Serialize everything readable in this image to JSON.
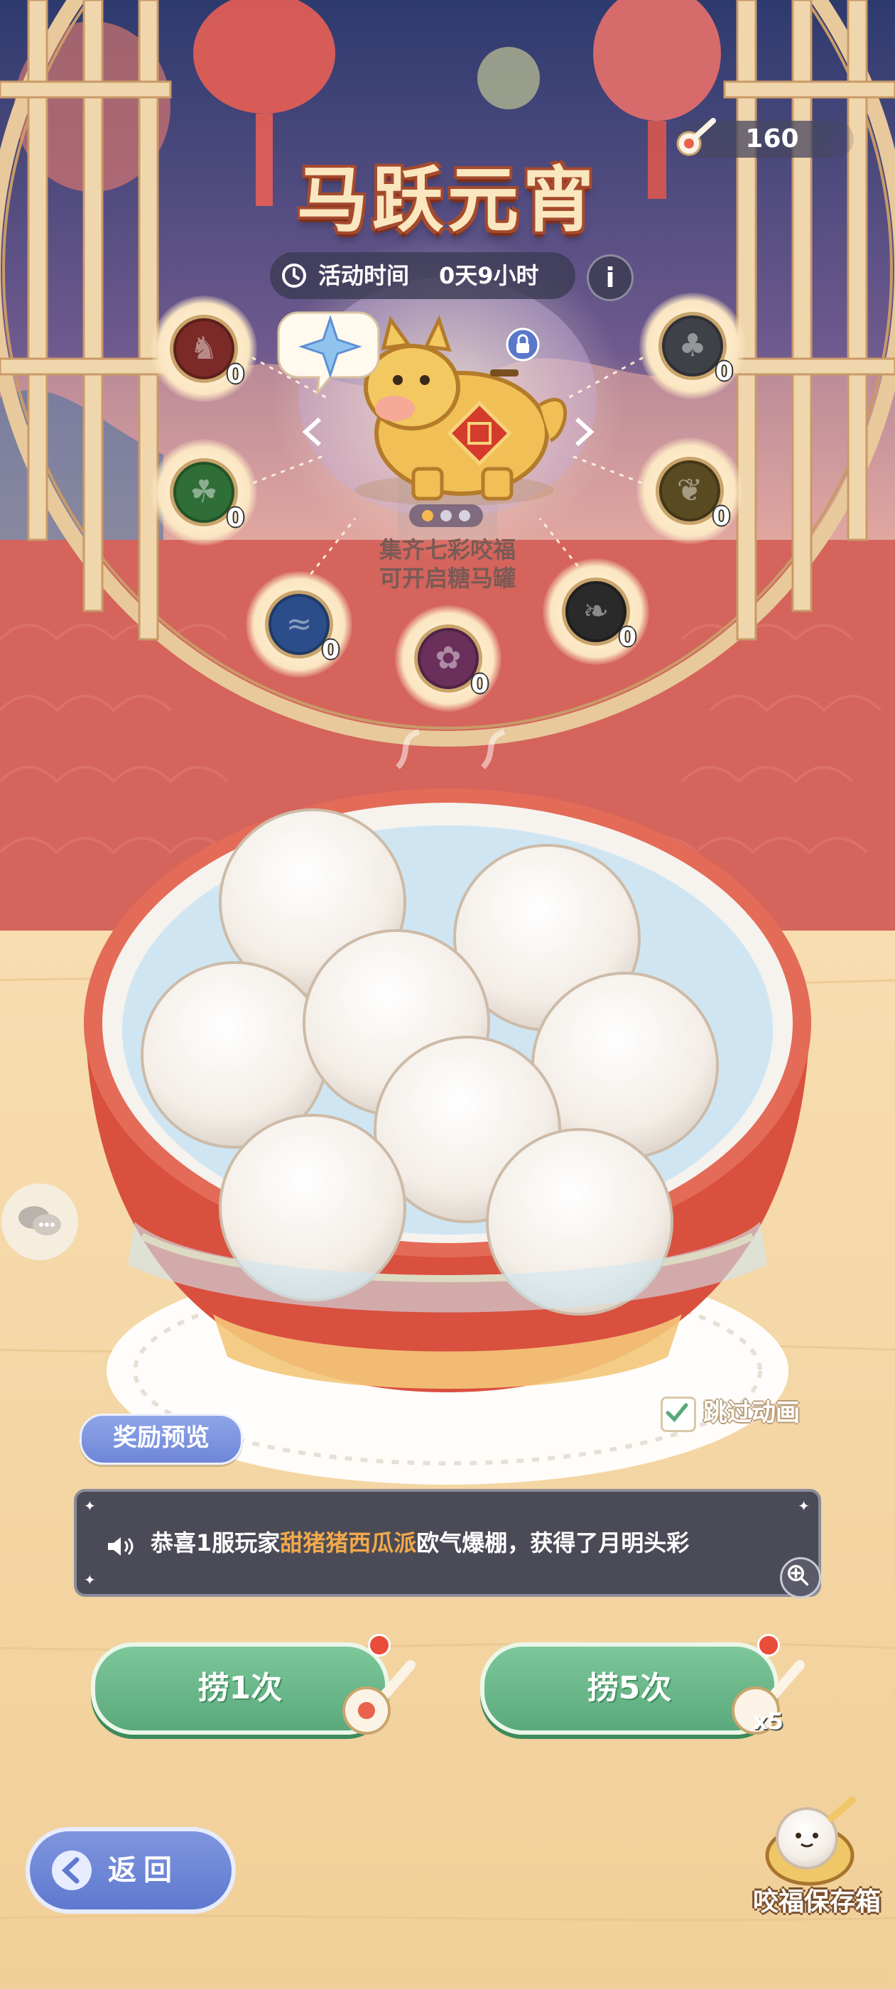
{
  "header": {
    "currency_value": "160",
    "title": "马跃元宵",
    "time_label": "活动时间",
    "time_value": "0天9小时",
    "info_glyph": "i"
  },
  "coins": [
    {
      "id": "coin-horse",
      "count": "0",
      "color": "#7c2a27"
    },
    {
      "id": "coin-clover",
      "count": "0",
      "color": "#2f6e37"
    },
    {
      "id": "coin-wave",
      "count": "0",
      "color": "#2b4e8a"
    },
    {
      "id": "coin-blossom",
      "count": "0",
      "color": "#6a2f5b"
    },
    {
      "id": "coin-bamboo",
      "count": "0",
      "color": "#2a2a2a"
    },
    {
      "id": "coin-wheat",
      "count": "0",
      "color": "#5a4a22"
    },
    {
      "id": "coin-bonsai",
      "count": "0",
      "color": "#3f4148"
    }
  ],
  "jar": {
    "hint_line1": "集齐七彩咬福",
    "hint_line2": "可开启糖马罐"
  },
  "controls": {
    "reward_preview": "奖励预览",
    "skip_animation": "跳过动画",
    "skip_checked": true
  },
  "ticker": {
    "prefix": "恭喜1服玩家",
    "player": "甜猪猪西瓜派",
    "suffix": "欧气爆棚，获得了月明头彩"
  },
  "draw_buttons": {
    "draw1": "捞1次",
    "draw5": "捞5次",
    "draw5_mult": "x5"
  },
  "nav": {
    "back": "返回",
    "storage": "咬福保存箱"
  },
  "colors": {
    "wall_red": "#d4645c",
    "button_green": "#6bbb8b",
    "button_blue": "#7489d8",
    "ticker_bg": "#4b4b57",
    "highlight_name": "#f2a94a"
  }
}
